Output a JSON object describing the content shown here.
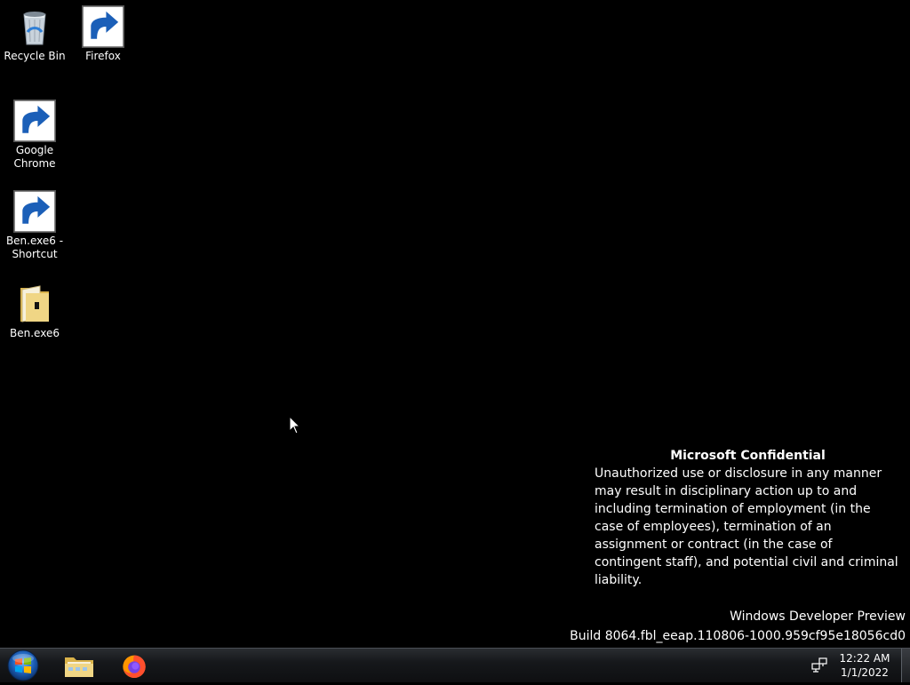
{
  "desktop": {
    "icons": [
      {
        "label": "Recycle Bin",
        "icon": "recycle-bin-icon"
      },
      {
        "label": "Firefox",
        "icon": "firefox-icon"
      },
      {
        "label": "Google Chrome",
        "icon": "chrome-icon"
      },
      {
        "label": "Ben.exe6 - Shortcut",
        "icon": "folder-shortcut-icon"
      },
      {
        "label": "Ben.exe6",
        "icon": "folder-icon"
      }
    ],
    "background_color": "#000000"
  },
  "watermark": {
    "title": "Microsoft Confidential",
    "body": "Unauthorized use or disclosure in any manner may result in disciplinary action up to and including termination of employment (in the case of employees), termination of an assignment or contract (in the case of contingent staff), and potential civil and criminal liability.",
    "edition": "Windows Developer Preview",
    "build": "Build 8064.fbl_eeap.110806-1000.959cf95e18056cd0"
  },
  "taskbar": {
    "pinned": [
      {
        "name": "Windows Explorer",
        "icon": "explorer-icon"
      },
      {
        "name": "Firefox",
        "icon": "firefox-icon"
      }
    ],
    "tray": {
      "network_icon": "network-icon"
    },
    "clock": {
      "time": "12:22 AM",
      "date": "1/1/2022"
    }
  }
}
